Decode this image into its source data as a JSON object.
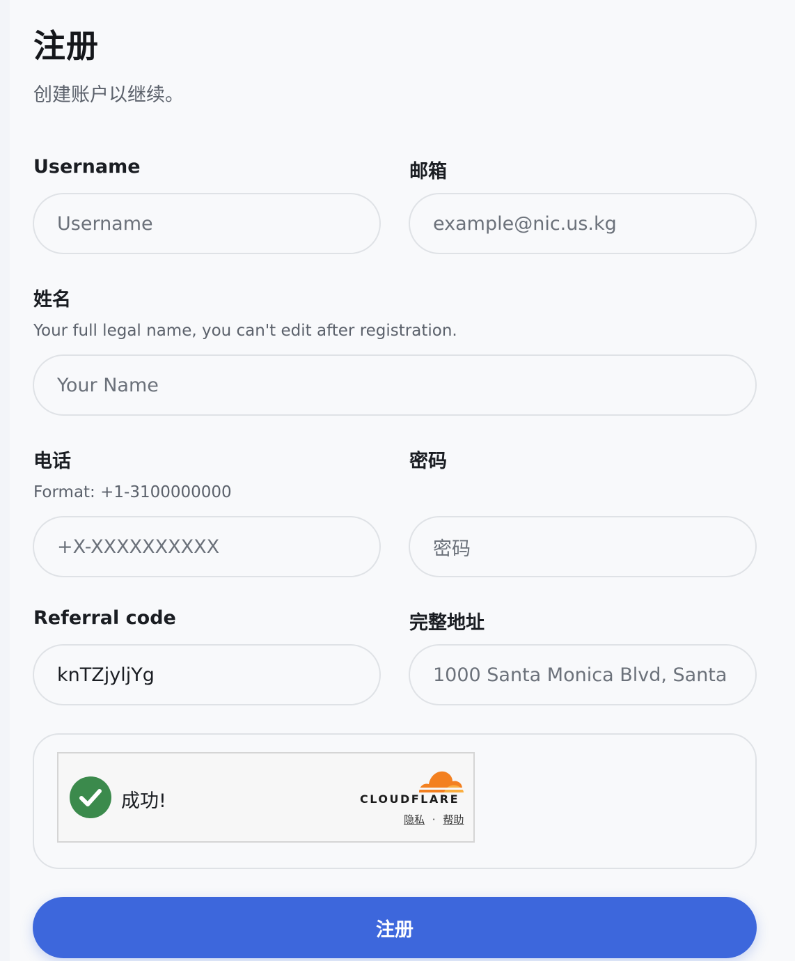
{
  "page": {
    "title": "注册",
    "subtitle": "创建账户以继续。"
  },
  "form": {
    "username": {
      "label": "Username",
      "placeholder": "Username"
    },
    "email": {
      "label": "邮箱",
      "placeholder": "example@nic.us.kg"
    },
    "name": {
      "label": "姓名",
      "hint": "Your full legal name, you can't edit after registration.",
      "placeholder": "Your Name"
    },
    "phone": {
      "label": "电话",
      "hint": "Format: +1-3100000000",
      "placeholder": "+X-XXXXXXXXXX"
    },
    "password": {
      "label": "密码",
      "placeholder": "密码"
    },
    "referral": {
      "label": "Referral code",
      "value": "knTZjyljYg"
    },
    "address": {
      "label": "完整地址",
      "placeholder": "1000 Santa Monica Blvd, Santa"
    }
  },
  "captcha": {
    "status": "成功!",
    "brand": "CLOUDFLARE",
    "privacy_link": "隐私",
    "separator": "·",
    "help_link": "帮助",
    "colors": {
      "check": "#3b8a4c",
      "cloud": "#f38020"
    }
  },
  "submit": {
    "label": "注册",
    "color": "#3d67dc"
  }
}
